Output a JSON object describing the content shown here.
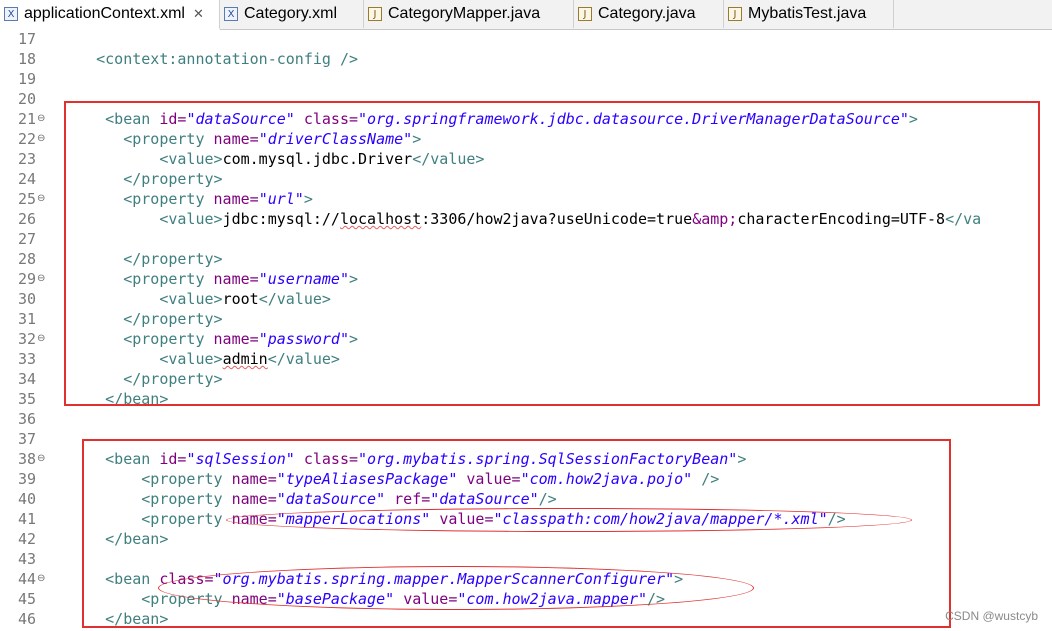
{
  "tabs": [
    {
      "label": "applicationContext.xml",
      "icon": "xml-file-icon",
      "active": true,
      "close": "✕"
    },
    {
      "label": "Category.xml",
      "icon": "xml-file-icon"
    },
    {
      "label": "CategoryMapper.java",
      "icon": "java-file-icon"
    },
    {
      "label": "Category.java",
      "icon": "java-file-icon"
    },
    {
      "label": "MybatisTest.java",
      "icon": "java-file-icon"
    }
  ],
  "lines": [
    {
      "n": "17",
      "fold": false,
      "parts": []
    },
    {
      "n": "18",
      "fold": false,
      "parts": [
        {
          "c": "t",
          "s": "    <context:annotation-config />"
        }
      ]
    },
    {
      "n": "19",
      "fold": false,
      "parts": []
    },
    {
      "n": "20",
      "fold": false,
      "parts": []
    },
    {
      "n": "21",
      "fold": true,
      "parts": [
        {
          "c": "t",
          "s": "     <bean "
        },
        {
          "c": "a",
          "s": "id="
        },
        {
          "c": "v",
          "s": "\"dataSource\""
        },
        {
          "c": "x",
          "s": " "
        },
        {
          "c": "a",
          "s": "class="
        },
        {
          "c": "v",
          "s": "\"org.springframework.jdbc.datasource.DriverManagerDataSource\""
        },
        {
          "c": "t",
          "s": ">"
        }
      ]
    },
    {
      "n": "22",
      "fold": true,
      "parts": [
        {
          "c": "t",
          "s": "       <property "
        },
        {
          "c": "a",
          "s": "name="
        },
        {
          "c": "v",
          "s": "\"driverClassName\""
        },
        {
          "c": "t",
          "s": ">"
        }
      ]
    },
    {
      "n": "23",
      "fold": false,
      "parts": [
        {
          "c": "t",
          "s": "           <value>"
        },
        {
          "c": "x",
          "s": "com.mysql.jdbc.Driver"
        },
        {
          "c": "t",
          "s": "</value>"
        }
      ]
    },
    {
      "n": "24",
      "fold": false,
      "parts": [
        {
          "c": "t",
          "s": "       </property>"
        }
      ]
    },
    {
      "n": "25",
      "fold": true,
      "parts": [
        {
          "c": "t",
          "s": "       <property "
        },
        {
          "c": "a",
          "s": "name="
        },
        {
          "c": "v",
          "s": "\"url\""
        },
        {
          "c": "t",
          "s": ">"
        }
      ]
    },
    {
      "n": "26",
      "fold": false,
      "parts": [
        {
          "c": "t",
          "s": "           <value>"
        },
        {
          "c": "x",
          "s": "jdbc:mysql://"
        },
        {
          "c": "x sq",
          "s": "localhost"
        },
        {
          "c": "x",
          "s": ":3306/how2java?useUnicode=true"
        },
        {
          "c": "a",
          "s": "&amp;"
        },
        {
          "c": "x",
          "s": "characterEncoding=UTF-8"
        },
        {
          "c": "t",
          "s": "</va"
        }
      ]
    },
    {
      "n": "27",
      "fold": false,
      "parts": []
    },
    {
      "n": "28",
      "fold": false,
      "parts": [
        {
          "c": "t",
          "s": "       </property>"
        }
      ]
    },
    {
      "n": "29",
      "fold": true,
      "parts": [
        {
          "c": "t",
          "s": "       <property "
        },
        {
          "c": "a",
          "s": "name="
        },
        {
          "c": "v",
          "s": "\"username\""
        },
        {
          "c": "t",
          "s": ">"
        }
      ]
    },
    {
      "n": "30",
      "fold": false,
      "parts": [
        {
          "c": "t",
          "s": "           <value>"
        },
        {
          "c": "x",
          "s": "root"
        },
        {
          "c": "t",
          "s": "</value>"
        }
      ]
    },
    {
      "n": "31",
      "fold": false,
      "parts": [
        {
          "c": "t",
          "s": "       </property>"
        }
      ]
    },
    {
      "n": "32",
      "fold": true,
      "parts": [
        {
          "c": "t",
          "s": "       <property "
        },
        {
          "c": "a",
          "s": "name="
        },
        {
          "c": "v",
          "s": "\"password\""
        },
        {
          "c": "t",
          "s": ">"
        }
      ]
    },
    {
      "n": "33",
      "fold": false,
      "parts": [
        {
          "c": "t",
          "s": "           <value>"
        },
        {
          "c": "x sq",
          "s": "admin"
        },
        {
          "c": "t",
          "s": "</value>"
        }
      ]
    },
    {
      "n": "34",
      "fold": false,
      "parts": [
        {
          "c": "t",
          "s": "       </property>"
        }
      ]
    },
    {
      "n": "35",
      "fold": false,
      "parts": [
        {
          "c": "t",
          "s": "     </bean>"
        }
      ]
    },
    {
      "n": "36",
      "fold": false,
      "parts": []
    },
    {
      "n": "37",
      "fold": false,
      "parts": []
    },
    {
      "n": "38",
      "fold": true,
      "parts": [
        {
          "c": "t",
          "s": "     <bean "
        },
        {
          "c": "a",
          "s": "id="
        },
        {
          "c": "v",
          "s": "\"sqlSession\""
        },
        {
          "c": "x",
          "s": " "
        },
        {
          "c": "a",
          "s": "class="
        },
        {
          "c": "v",
          "s": "\"org.mybatis.spring.SqlSessionFactoryBean\""
        },
        {
          "c": "t",
          "s": ">"
        }
      ]
    },
    {
      "n": "39",
      "fold": false,
      "parts": [
        {
          "c": "t",
          "s": "         <property "
        },
        {
          "c": "a",
          "s": "name="
        },
        {
          "c": "v",
          "s": "\"typeAliasesPackage\""
        },
        {
          "c": "x",
          "s": " "
        },
        {
          "c": "a",
          "s": "value="
        },
        {
          "c": "v",
          "s": "\"com.how2java.pojo\""
        },
        {
          "c": "x",
          "s": " "
        },
        {
          "c": "t",
          "s": "/>"
        }
      ]
    },
    {
      "n": "40",
      "fold": false,
      "parts": [
        {
          "c": "t",
          "s": "         <property "
        },
        {
          "c": "a",
          "s": "name="
        },
        {
          "c": "v",
          "s": "\"dataSource\""
        },
        {
          "c": "x",
          "s": " "
        },
        {
          "c": "a",
          "s": "ref="
        },
        {
          "c": "v",
          "s": "\"dataSource\""
        },
        {
          "c": "t",
          "s": "/>"
        }
      ]
    },
    {
      "n": "41",
      "fold": false,
      "parts": [
        {
          "c": "t",
          "s": "         <property "
        },
        {
          "c": "a",
          "s": "name="
        },
        {
          "c": "v",
          "s": "\"mapperLocations\""
        },
        {
          "c": "x",
          "s": " "
        },
        {
          "c": "a",
          "s": "value="
        },
        {
          "c": "v",
          "s": "\"classpath:com/how2java/mapper/*.xml\""
        },
        {
          "c": "t",
          "s": "/>"
        }
      ]
    },
    {
      "n": "42",
      "fold": false,
      "parts": [
        {
          "c": "t",
          "s": "     </bean>"
        }
      ]
    },
    {
      "n": "43",
      "fold": false,
      "parts": []
    },
    {
      "n": "44",
      "fold": true,
      "parts": [
        {
          "c": "t",
          "s": "     <bean "
        },
        {
          "c": "a",
          "s": "class="
        },
        {
          "c": "v",
          "s": "\"org.mybatis.spring.mapper.MapperScannerConfigurer\""
        },
        {
          "c": "t",
          "s": ">"
        }
      ]
    },
    {
      "n": "45",
      "fold": false,
      "parts": [
        {
          "c": "t",
          "s": "         <property "
        },
        {
          "c": "a",
          "s": "name="
        },
        {
          "c": "v",
          "s": "\"basePackage\""
        },
        {
          "c": "x",
          "s": " "
        },
        {
          "c": "a",
          "s": "value="
        },
        {
          "c": "v",
          "s": "\"com.how2java.mapper\""
        },
        {
          "c": "t",
          "s": "/>"
        }
      ]
    },
    {
      "n": "46",
      "fold": false,
      "parts": [
        {
          "c": "t",
          "s": "     </bean>"
        }
      ]
    }
  ],
  "colors": {
    "tag": "#3f7f7f",
    "attribute": "#7f007f",
    "attr_value": "#2a00ff",
    "annotation": "#e03030"
  },
  "watermark": "CSDN @wustcyb"
}
